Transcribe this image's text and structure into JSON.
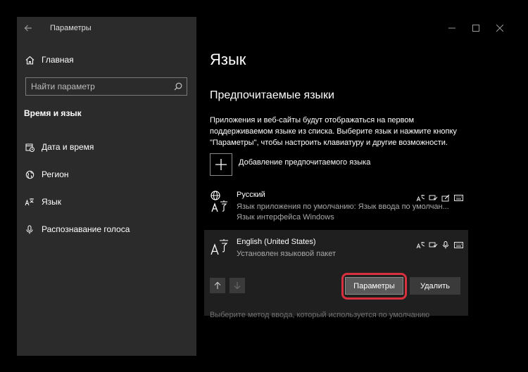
{
  "window": {
    "title": "Параметры"
  },
  "sidebar": {
    "home_label": "Главная",
    "search_placeholder": "Найти параметр",
    "section_label": "Время и язык",
    "items": [
      {
        "label": "Дата и время",
        "icon": "calendar-clock-icon"
      },
      {
        "label": "Регион",
        "icon": "globe-icon"
      },
      {
        "label": "Язык",
        "icon": "language-icon"
      },
      {
        "label": "Распознавание голоса",
        "icon": "microphone-icon"
      }
    ]
  },
  "main": {
    "page_title": "Язык",
    "sub_title": "Предпочитаемые языки",
    "description": "Приложения и веб-сайты будут отображаться на первом поддерживаемом языке из списка. Выберите язык и нажмите кнопку \"Параметры\", чтобы настроить клавиатуру и другие возможности.",
    "add_language_label": "Добавление предпочитаемого языка",
    "languages": [
      {
        "name": "Русский",
        "line1": "Язык приложения по умолчанию: Язык ввода по умолчан...",
        "line2": "Язык интерфейса Windows"
      },
      {
        "name": "English (United States)",
        "line1": "Установлен языковой пакет"
      }
    ],
    "params_button": "Параметры",
    "delete_button": "Удалить",
    "input_method_text": "Выберите метод ввода, который используется по умолчанию"
  },
  "colors": {
    "sidebar_bg": "#2b2b2b",
    "highlight_ring": "#d8303f",
    "selected_row_bg": "#1f1f1f"
  }
}
